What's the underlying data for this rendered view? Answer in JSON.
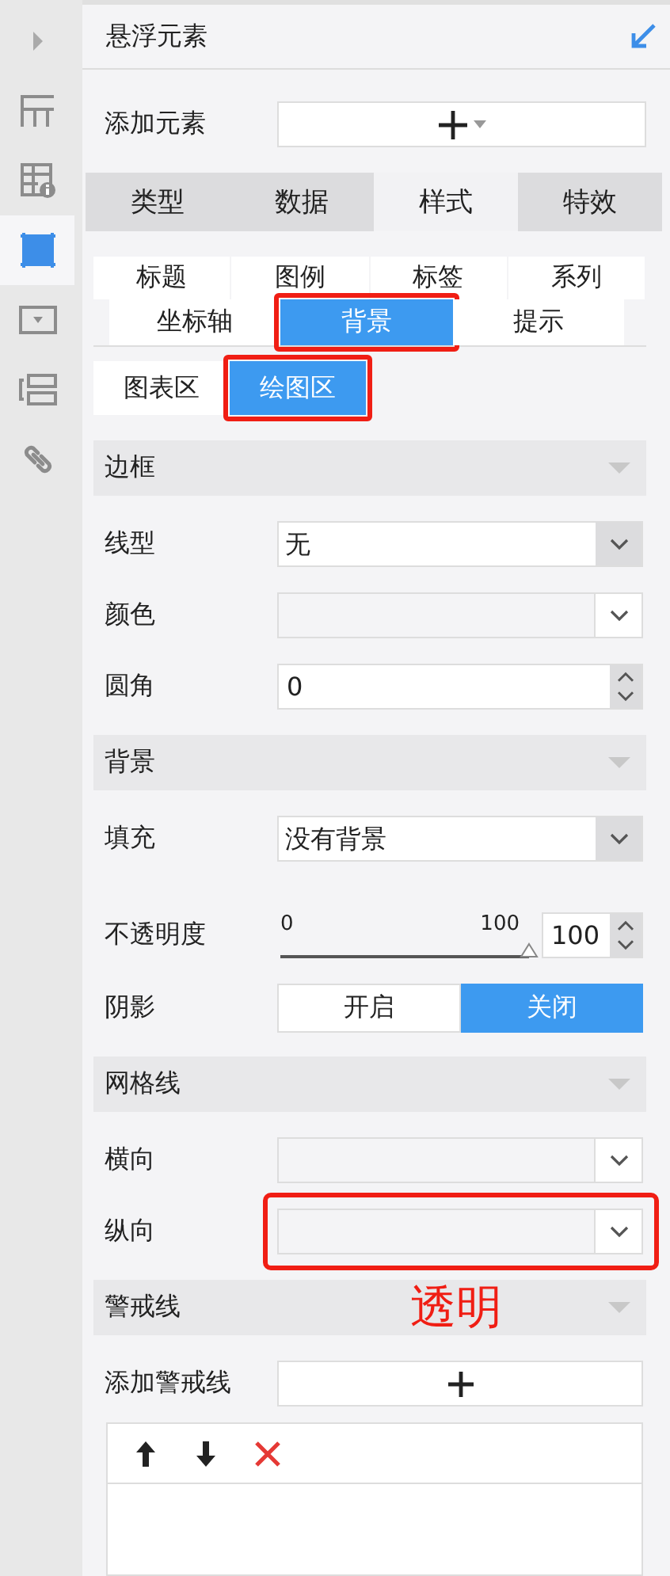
{
  "sidebar": {
    "items": [
      {
        "kind": "expand",
        "selected": false
      },
      {
        "kind": "layout",
        "selected": false
      },
      {
        "kind": "info-grid",
        "selected": false
      },
      {
        "kind": "frame",
        "selected": true
      },
      {
        "kind": "dropdown",
        "selected": false
      },
      {
        "kind": "form",
        "selected": false
      },
      {
        "kind": "link",
        "selected": false
      }
    ]
  },
  "panel": {
    "title": "悬浮元素"
  },
  "add_element": {
    "label": "添加元素"
  },
  "main_tabs": [
    {
      "label": "类型",
      "selected": false
    },
    {
      "label": "数据",
      "selected": false
    },
    {
      "label": "样式",
      "selected": true
    },
    {
      "label": "特效",
      "selected": false
    }
  ],
  "sub_tabs": [
    [
      {
        "label": "标题",
        "selected": false,
        "highlighted": false
      },
      {
        "label": "图例",
        "selected": false,
        "highlighted": false
      },
      {
        "label": "标签",
        "selected": false,
        "highlighted": false
      },
      {
        "label": "系列",
        "selected": false,
        "highlighted": false
      }
    ],
    [
      {
        "label": "坐标轴",
        "selected": false,
        "highlighted": false
      },
      {
        "label": "背景",
        "selected": true,
        "highlighted": true
      },
      {
        "label": "提示",
        "selected": false,
        "highlighted": false
      }
    ]
  ],
  "area_tabs": [
    {
      "label": "图表区",
      "selected": false,
      "highlighted": false
    },
    {
      "label": "绘图区",
      "selected": true,
      "highlighted": true
    }
  ],
  "sections": [
    {
      "title": "边框",
      "rows": [
        {
          "kind": "select",
          "label": "线型",
          "value": "无"
        },
        {
          "kind": "color",
          "label": "颜色",
          "highlighted": false
        },
        {
          "kind": "number",
          "label": "圆角",
          "value": "0"
        }
      ]
    },
    {
      "title": "背景",
      "rows": [
        {
          "kind": "select",
          "label": "填充",
          "value": "没有背景"
        },
        {
          "kind": "slider",
          "label": "不透明度",
          "min": "0",
          "max": "100",
          "level": 1,
          "value": "100"
        },
        {
          "kind": "toggle",
          "label": "阴影",
          "options": [
            {
              "label": "开启",
              "selected": false
            },
            {
              "label": "关闭",
              "selected": true
            }
          ]
        }
      ]
    },
    {
      "title": "网格线",
      "rows": [
        {
          "kind": "color",
          "label": "横向",
          "highlighted": false
        },
        {
          "kind": "color",
          "label": "纵向",
          "highlighted": true
        }
      ]
    },
    {
      "title": "警戒线",
      "note": "透明",
      "rows": [
        {
          "kind": "add",
          "label": "添加警戒线"
        },
        {
          "kind": "list",
          "tools": [
            {
              "kind": "up"
            },
            {
              "kind": "down"
            },
            {
              "kind": "delete"
            }
          ]
        }
      ]
    }
  ]
}
